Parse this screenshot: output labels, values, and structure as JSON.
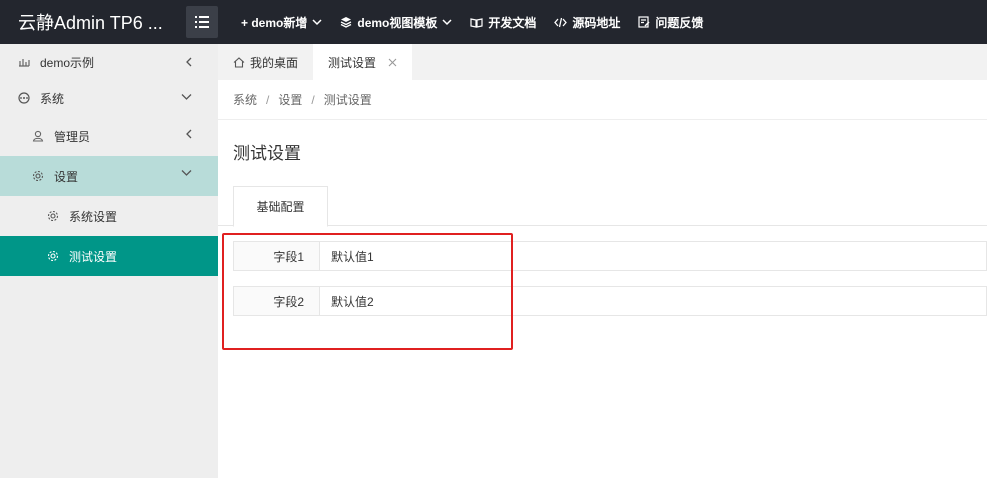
{
  "header": {
    "logo": "云静Admin TP6 ...",
    "nav": [
      {
        "label": "+ demo新增",
        "icon": "",
        "dropdown": true
      },
      {
        "label": "demo视图模板",
        "icon": "layers-icon",
        "dropdown": true
      },
      {
        "label": "开发文档",
        "icon": "book-icon",
        "dropdown": false
      },
      {
        "label": "源码地址",
        "icon": "code-icon",
        "dropdown": false
      },
      {
        "label": "问题反馈",
        "icon": "feedback-icon",
        "dropdown": false
      }
    ]
  },
  "sidebar": {
    "items": [
      {
        "label": "demo示例"
      },
      {
        "label": "系统"
      },
      {
        "label": "管理员"
      },
      {
        "label": "设置"
      },
      {
        "label": "系统设置"
      },
      {
        "label": "测试设置"
      }
    ]
  },
  "tabs": {
    "home": "我的桌面",
    "current": "测试设置"
  },
  "breadcrumb": [
    "系统",
    "设置",
    "测试设置"
  ],
  "breadcrumb_sep": "/",
  "page": {
    "title": "测试设置",
    "tab": "基础配置",
    "fields": [
      {
        "label": "字段1",
        "value": "默认值1"
      },
      {
        "label": "字段2",
        "value": "默认值2"
      }
    ]
  },
  "colors": {
    "topbar": "#23262e",
    "active": "#009688",
    "open": "#b8dcd9",
    "highlight": "#e02020"
  }
}
